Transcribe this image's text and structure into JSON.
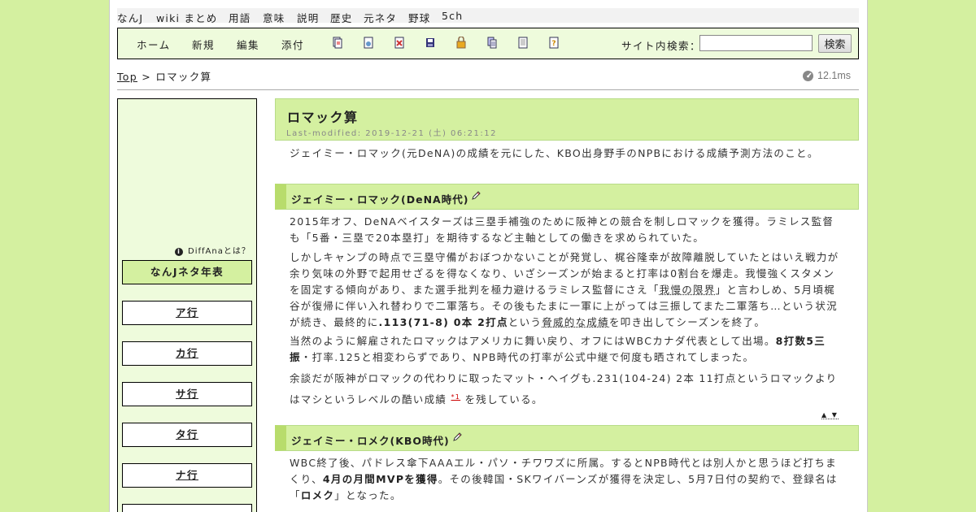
{
  "top_nav": [
    "なんJ",
    "wiki まとめ",
    "用語",
    "意味",
    "説明",
    "歴史",
    "元ネタ",
    "野球",
    "5ch"
  ],
  "toolbar": {
    "menu": [
      "ホーム",
      "新規",
      "編集",
      "添付"
    ],
    "icons": [
      "copy-page-icon",
      "rename-page-icon",
      "diff-page-icon",
      "backup-page-icon",
      "freeze-page-icon",
      "page-list-icon",
      "recent-changes-icon",
      "help-icon"
    ],
    "search_label": "サイト内検索：",
    "search_button": "検索",
    "search_value": ""
  },
  "breadcrumb": {
    "top": "Top",
    "sep": " > ",
    "current": "ロマック算"
  },
  "timing": "12.1ms",
  "sidebar": {
    "diffana": "DiffAnaとは？",
    "items": [
      "なんJネタ年表",
      "ア行",
      "カ行",
      "サ行",
      "タ行",
      "ナ行"
    ]
  },
  "page": {
    "title": "ロマック算",
    "last_modified": "Last-modified: 2019-12-21 (土) 06:21:12",
    "intro": "ジェイミー・ロマック(元DeNA)の成績を元にした、KBO出身野手のNPBにおける成績予測方法のこと。"
  },
  "section1": {
    "heading": "ジェイミー・ロマック(DeNA時代)",
    "p1": "2015年オフ、DeNAベイスターズは三塁手補強のために阪神との競合を制しロマックを獲得。ラミレス監督も「5番・三塁で20本塁打」を期待するなど主軸としての働きを求められていた。",
    "p2_a": "しかしキャンプの時点で三塁守備がおぼつかないことが発覚し、梶谷隆幸が故障離脱していたとはいえ戦力が余り気味の外野で起用せざるを得なくなり、いざシーズンが始まると打率は0割台を爆走。我慢強くスタメンを固定する傾向があり、また選手批判を極力避けるラミレス監督にさえ「",
    "p2_link": "我慢の限界",
    "p2_b": "」と言わしめ、5月頃梶谷が復帰に伴い入れ替わりで二軍落ち。その後もたまに一軍に上がっては三振してまた二軍落ち…という状況が続き、最終的に",
    "p2_bold": ".113(71-8) 0本 2打点",
    "p2_c": "という",
    "p2_link2": "脅威的な成績",
    "p2_d": "を叩き出してシーズンを終了。",
    "p3_a": "当然のように解雇されたロマックはアメリカに舞い戻り、オフにはWBCカナダ代表として出場。",
    "p3_bold": "8打数5三振",
    "p3_b": "・打率.125と相変わらずであり、NPB時代の打率が公式中継で何度も晒されてしまった。",
    "p4_a": "余談だが阪神がロマックの代わりに取ったマット・ヘイグも.231(104-24) 2本 11打点というロマックよりはマシというレベルの酷い成績",
    "p4_fn": "*1",
    "p4_b": "を残している。",
    "nav": "▲ ▼"
  },
  "section2": {
    "heading": "ジェイミー・ロメク(KBO時代)",
    "p1_a": "WBC終了後、パドレス傘下AAAエル・パソ・チワワズに所属。するとNPB時代とは別人かと思うほど打ちまくり、",
    "p1_bold": "4月の月間MVPを獲得",
    "p1_b": "。その後韓国・SKワイバーンズが獲得を決定し、5月7日付の契約で、登録名は「",
    "p1_bold2": "ロメク",
    "p1_c": "」となった。"
  },
  "colors": {
    "background": "#d4f0a0",
    "accent": "#b8dc6c",
    "sidebar": "#eefbdc"
  }
}
